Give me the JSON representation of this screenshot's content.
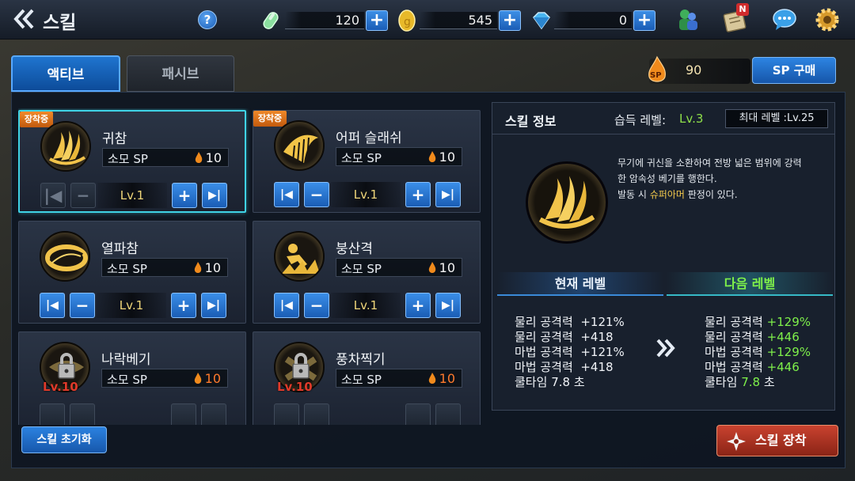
{
  "header": {
    "title": "스킬",
    "resources": [
      {
        "name": "energy",
        "icon": "energy-capsule-icon",
        "value": "120"
      },
      {
        "name": "gold",
        "icon": "gold-coin-icon",
        "value": "545"
      },
      {
        "name": "gem",
        "icon": "diamond-icon",
        "value": "0"
      }
    ],
    "notification_badge": "N"
  },
  "tabs": [
    {
      "label": "액티브",
      "active": true
    },
    {
      "label": "패시브",
      "active": false
    }
  ],
  "sp": {
    "value": "90",
    "icon_label": "SP",
    "buy_label": "SP 구매"
  },
  "skills": [
    {
      "name": "귀참",
      "equip_badge": "장착중",
      "cost_label": "소모 SP",
      "cost": "10",
      "level": "Lv.1",
      "locked": false
    },
    {
      "name": "어퍼 슬래쉬",
      "equip_badge": "장착중",
      "cost_label": "소모 SP",
      "cost": "10",
      "level": "Lv.1",
      "locked": false
    },
    {
      "name": "열파참",
      "equip_badge": "",
      "cost_label": "소모 SP",
      "cost": "10",
      "level": "Lv.1",
      "locked": false
    },
    {
      "name": "붕산격",
      "equip_badge": "",
      "cost_label": "소모 SP",
      "cost": "10",
      "level": "Lv.1",
      "locked": false
    },
    {
      "name": "나락베기",
      "equip_badge": "",
      "cost_label": "소모 SP",
      "cost": "10",
      "lock_level": "Lv.10",
      "locked": true
    },
    {
      "name": "풍차찍기",
      "equip_badge": "",
      "cost_label": "소모 SP",
      "cost": "10",
      "lock_level": "Lv.10",
      "locked": true
    }
  ],
  "info": {
    "title": "스킬 정보",
    "learn_label": "습득 레벨:",
    "learn_value": "Lv.3",
    "max_level": "최대 레벨 :Lv.25",
    "desc_line1": "무기에 귀신을 소환하여 전방 넓은 범위에 강력",
    "desc_line2": "한 암속성 베기를 행한다.",
    "desc_line3_pre": "발동 시 ",
    "desc_line3_hl": "슈퍼아머",
    "desc_line3_post": " 판정이 있다.",
    "current_header": "현재 레벨",
    "next_header": "다음 레벨",
    "current_stats": [
      {
        "label": "물리 공격력",
        "value": "+121%"
      },
      {
        "label": "물리 공격력",
        "value": "+418"
      },
      {
        "label": "마법 공격력",
        "value": "+121%"
      },
      {
        "label": "마법 공격력",
        "value": "+418"
      },
      {
        "label": "쿨타임",
        "value": "7.8",
        "unit": "초"
      }
    ],
    "next_stats": [
      {
        "label": "물리 공격력",
        "value": "+129%"
      },
      {
        "label": "물리 공격력",
        "value": "+446"
      },
      {
        "label": "마법 공격력",
        "value": "+129%"
      },
      {
        "label": "마법 공격력",
        "value": "+446"
      },
      {
        "label": "쿨타임",
        "value": "7.8",
        "unit": "초"
      }
    ]
  },
  "buttons": {
    "reset": "스킬 초기화",
    "equip": "스킬 장착"
  }
}
